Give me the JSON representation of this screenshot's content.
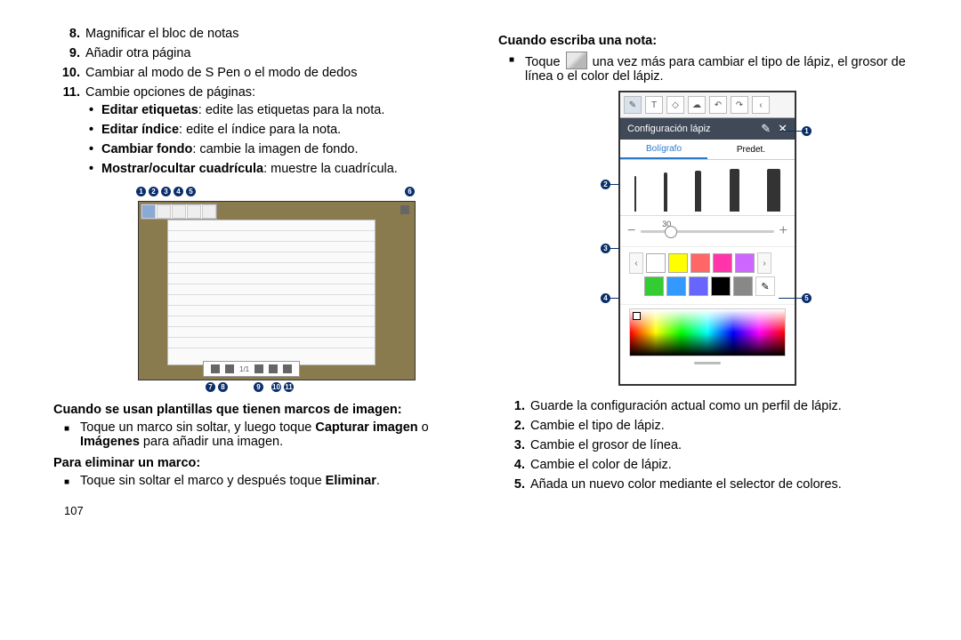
{
  "left": {
    "list_start": 8,
    "items": [
      "Magnificar el bloc de notas",
      "Añadir otra página",
      "Cambiar al modo de S Pen o el modo de dedos",
      "Cambie opciones de páginas:"
    ],
    "subitems": [
      {
        "b": "Editar etiquetas",
        "t": ": edite las etiquetas para la nota."
      },
      {
        "b": "Editar índice",
        "t": ": edite el índice para la nota."
      },
      {
        "b": "Cambiar fondo",
        "t": ": cambie la imagen de fondo."
      },
      {
        "b": "Mostrar/ocultar cuadrícula",
        "t": ": muestre la cuadrícula."
      }
    ],
    "fig1": {
      "callouts_top": [
        "1",
        "2",
        "3",
        "4",
        "5"
      ],
      "callout_right": "6",
      "callouts_bot": [
        "7",
        "8",
        "9",
        "10",
        "11"
      ],
      "page_indicator": "1/1"
    },
    "heading1": "Cuando se usan plantillas que tienen marcos de imagen:",
    "bullet1_a": "Toque un marco sin soltar, y luego toque ",
    "bullet1_b": "Capturar imagen",
    "bullet1_c": " o ",
    "bullet1_d": "Imágenes",
    "bullet1_e": " para añadir una imagen.",
    "heading2": "Para eliminar un marco:",
    "bullet2_a": "Toque sin soltar el marco y después toque ",
    "bullet2_b": "Eliminar",
    "bullet2_c": ".",
    "page_num": "107"
  },
  "right": {
    "heading": "Cuando escriba una nota:",
    "intro_a": "Toque ",
    "intro_b": " una vez más para cambiar el tipo de lápiz, el grosor de línea o el color del lápiz.",
    "fig2": {
      "cfg_title": "Configuración lápiz",
      "tab_active": "Bolígrafo",
      "tab_other": "Predet.",
      "size_value": "30",
      "minus": "−",
      "plus": "+",
      "chev_l": "‹",
      "chev_r": "›",
      "close": "✕",
      "save_char": "✎",
      "palette_row1": [
        "#ffffff",
        "#ffff00",
        "#ff6666",
        "#ff33aa",
        "#cc66ff"
      ],
      "palette_row2": [
        "#33cc33",
        "#3399ff",
        "#6666ff",
        "#000000",
        "#888888"
      ],
      "callouts": [
        "1",
        "2",
        "3",
        "4",
        "5"
      ]
    },
    "list": [
      "Guarde la configuración actual como un perfil de lápiz.",
      "Cambie el tipo de lápiz.",
      "Cambie el grosor de línea.",
      "Cambie el color de lápiz.",
      "Añada un nuevo color mediante el selector de colores."
    ]
  }
}
